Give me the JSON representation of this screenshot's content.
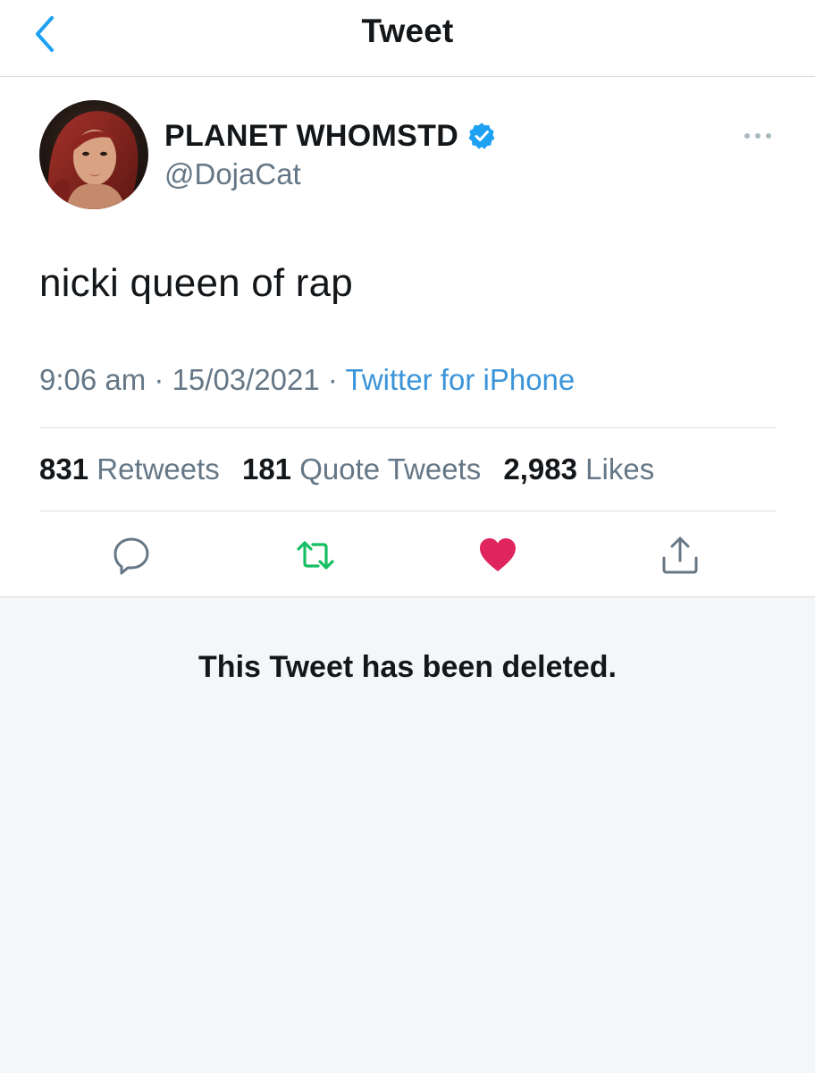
{
  "header": {
    "title": "Tweet",
    "back_icon": "chevron-left-icon"
  },
  "tweet": {
    "author": {
      "display_name": "PLANET WHOMSTD",
      "handle": "@DojaCat",
      "verified": true
    },
    "text": "nicki queen of rap",
    "time": "9:06 am",
    "separator": " · ",
    "date": "15/03/2021",
    "source": "Twitter for iPhone",
    "stats": {
      "retweets_count": "831",
      "retweets_label": "Retweets",
      "quotes_count": "181",
      "quotes_label": "Quote Tweets",
      "likes_count": "2,983",
      "likes_label": "Likes"
    },
    "actions": [
      "reply-icon",
      "retweet-icon",
      "heart-icon",
      "share-icon"
    ],
    "liked": true
  },
  "reply": {
    "deleted_notice": "This Tweet has been deleted."
  },
  "colors": {
    "accent": "#1DA1F2",
    "retweet_green": "#17BF63",
    "like_red": "#E0245E",
    "secondary_text": "#657786"
  }
}
